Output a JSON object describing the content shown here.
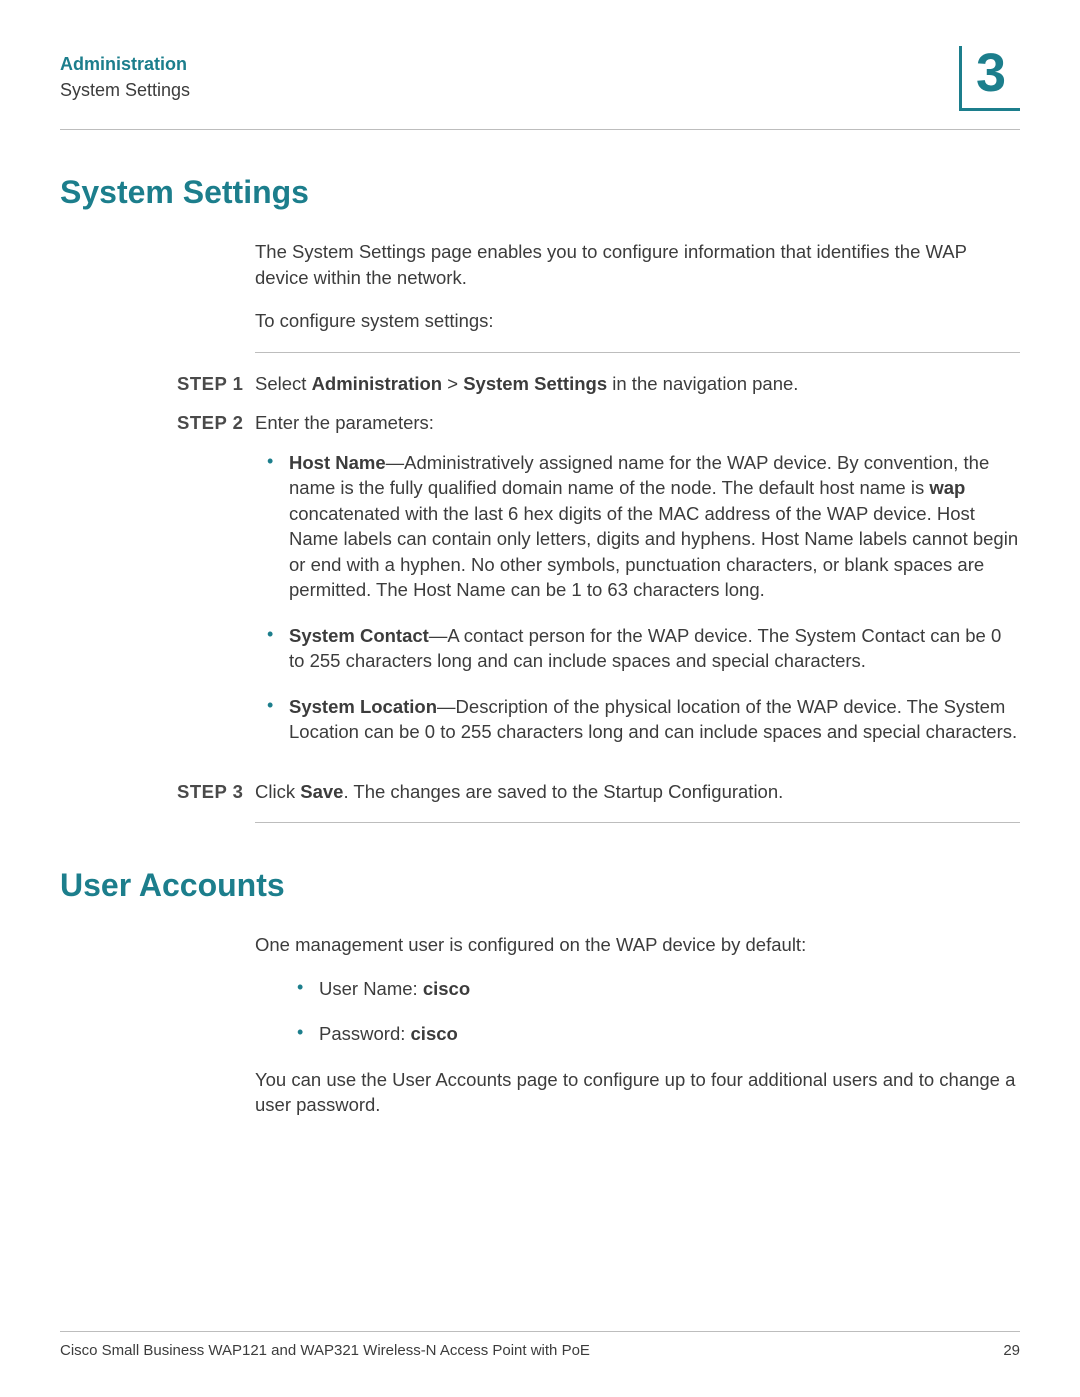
{
  "header": {
    "chapter": "Administration",
    "section": "System Settings",
    "chapter_number": "3"
  },
  "section1": {
    "heading": "System Settings",
    "intro_p1": "The System Settings page enables you to configure information that identifies the WAP device within the network.",
    "intro_p2": "To configure system settings:",
    "steps": {
      "s1": {
        "label": "STEP 1",
        "t1": "Select ",
        "b1": "Administration",
        "t2": " > ",
        "b2": "System Settings",
        "t3": " in the navigation pane."
      },
      "s2": {
        "label": "STEP 2",
        "t1": "Enter the parameters:"
      },
      "s3": {
        "label": "STEP 3",
        "t1": "Click ",
        "b1": "Save",
        "t2": ". The changes are saved to the Startup Configuration."
      }
    },
    "bullets": {
      "b1": {
        "term": "Host Name",
        "rest": "—Administratively assigned name for the WAP device. By convention, the name is the fully qualified domain name of the node. The default host name is ",
        "code": "wap",
        "rest2": " concatenated with the last 6 hex digits of the MAC address of the WAP device. Host Name labels can contain only letters, digits and hyphens. Host Name labels cannot begin or end with a hyphen. No other symbols, punctuation characters, or blank spaces are permitted. The Host Name can be 1 to 63 characters long."
      },
      "b2": {
        "term": "System Contact",
        "rest": "—A contact person for the WAP device. The System Contact can be 0 to 255 characters long and can include spaces and special characters."
      },
      "b3": {
        "term": "System Location",
        "rest": "—Description of the physical location of the WAP device. The System Location can be 0 to 255 characters long and can include spaces and special characters."
      }
    }
  },
  "section2": {
    "heading": "User Accounts",
    "p1": "One management user is configured on the WAP device by default:",
    "bullets": {
      "b1": {
        "label": "User Name: ",
        "value": "cisco"
      },
      "b2": {
        "label": "Password: ",
        "value": "cisco"
      }
    },
    "p2": "You can use the User Accounts page to configure up to four additional users and to change a user password."
  },
  "footer": {
    "title": "Cisco Small Business WAP121 and WAP321 Wireless-N Access Point with PoE",
    "page": "29"
  }
}
